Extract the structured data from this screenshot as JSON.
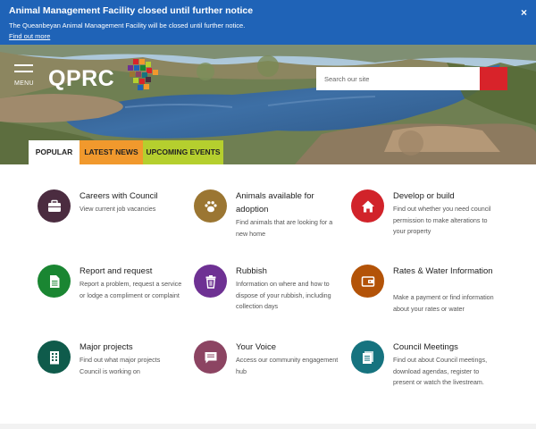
{
  "alert": {
    "title": "Animal Management Facility closed until further notice",
    "text": "The Queanbeyan Animal Management Facility will be closed until further notice.",
    "link": "Find out more",
    "close_icon": "×"
  },
  "header": {
    "menu_label": "MENU",
    "logo_text": "QPRC",
    "search_placeholder": "Search our site"
  },
  "tabs": [
    {
      "label": "POPULAR",
      "color": "#ffffff"
    },
    {
      "label": "LATEST NEWS",
      "color": "#f1992d"
    },
    {
      "label": "UPCOMING EVENTS",
      "color": "#b5cf2e"
    }
  ],
  "cards": [
    {
      "title": "Careers with Council",
      "desc": "View current job vacancies",
      "color": "#4b2c40",
      "icon": "briefcase-icon"
    },
    {
      "title": "Animals available for adoption",
      "desc": "Find animals that are looking for a new home",
      "color": "#9b7632",
      "icon": "paw-icon"
    },
    {
      "title": "Develop or build",
      "desc": "Find out whether you need council permission to make alterations to your property",
      "color": "#d1232a",
      "icon": "house-icon"
    },
    {
      "title": "Report and request",
      "desc": "Report a problem, request a service or lodge a compliment or complaint",
      "color": "#1a8632",
      "icon": "document-icon"
    },
    {
      "title": "Rubbish",
      "desc": "Information on where and how to dispose of your rubbish, including collection days",
      "color": "#6e3193",
      "icon": "bin-icon"
    },
    {
      "title": "Rates & Water Information",
      "desc": "Make a payment or find information about your rates or water",
      "color": "#b35308",
      "icon": "wallet-icon"
    },
    {
      "title": "Major projects",
      "desc": "Find out what major projects Council is working on",
      "color": "#0f5b4b",
      "icon": "building-icon"
    },
    {
      "title": "Your Voice",
      "desc": "Access our community engagement hub",
      "color": "#8c4462",
      "icon": "speech-bubble-icon"
    },
    {
      "title": "Council Meetings",
      "desc": "Find out about Council meetings, download agendas, register to present or watch the livestream.",
      "color": "#16737f",
      "icon": "papers-icon"
    }
  ]
}
